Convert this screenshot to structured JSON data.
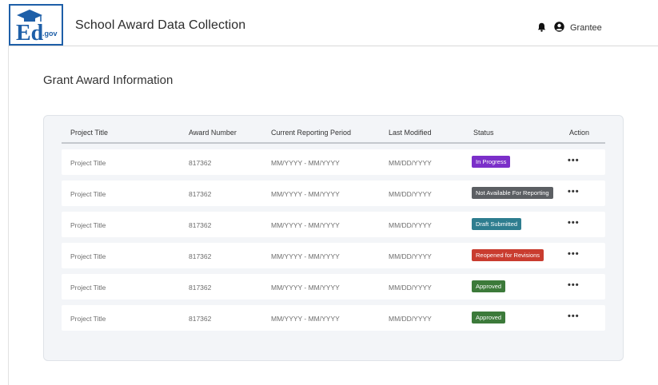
{
  "header": {
    "logo_text": ".gov",
    "app_title": "School Award Data Collection",
    "user_label": "Grantee",
    "icons": [
      "bell-icon",
      "user-circle-icon"
    ]
  },
  "page": {
    "title": "Grant Award Information"
  },
  "table": {
    "columns": [
      "Project Title",
      "Award Number",
      "Current Reporting Period",
      "Last Modified",
      "Status",
      "Action"
    ],
    "rows": [
      {
        "project": "Project Title",
        "award": "817362",
        "period": "MM/YYYY - MM/YYYY",
        "modified": "MM/DD/YYYY",
        "status": "In Progress",
        "status_color": "#7b2fc9",
        "action": "•••"
      },
      {
        "project": "Project Title",
        "award": "817362",
        "period": "MM/YYYY - MM/YYYY",
        "modified": "MM/DD/YYYY",
        "status": "Not Available For Reporting",
        "status_color": "#5c5f63",
        "action": "•••"
      },
      {
        "project": "Project Title",
        "award": "817362",
        "period": "MM/YYYY - MM/YYYY",
        "modified": "MM/DD/YYYY",
        "status": "Draft Submitted",
        "status_color": "#2e7d8f",
        "action": "•••"
      },
      {
        "project": "Project Title",
        "award": "817362",
        "period": "MM/YYYY - MM/YYYY",
        "modified": "MM/DD/YYYY",
        "status": "Reopened for Revisions",
        "status_color": "#c93c2f",
        "action": "•••"
      },
      {
        "project": "Project Title",
        "award": "817362",
        "period": "MM/YYYY - MM/YYYY",
        "modified": "MM/DD/YYYY",
        "status": "Approved",
        "status_color": "#3c7a3a",
        "action": "•••"
      },
      {
        "project": "Project Title",
        "award": "817362",
        "period": "MM/YYYY - MM/YYYY",
        "modified": "MM/DD/YYYY",
        "status": "Approved",
        "status_color": "#3c7a3a",
        "action": "•••"
      }
    ]
  }
}
